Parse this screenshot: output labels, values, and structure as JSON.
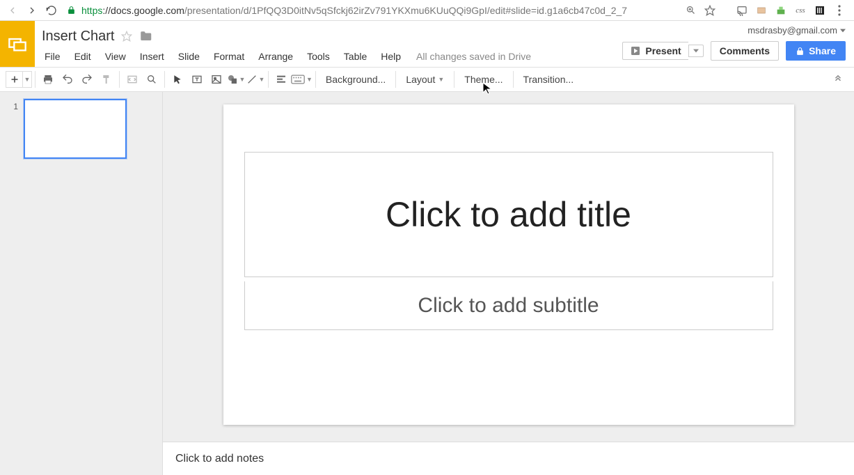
{
  "browser": {
    "url_scheme": "https",
    "url_host": "://docs.google.com",
    "url_path": "/presentation/d/1PfQQ3D0itNv5qSfckj62irZv791YKXmu6KUuQQi9GpI/edit#slide=id.g1a6cb47c0d_2_7",
    "ext_label_css": "css"
  },
  "doc": {
    "title": "Insert Chart",
    "save_status": "All changes saved in Drive"
  },
  "account": {
    "email": "msdrasby@gmail.com"
  },
  "menus": [
    "File",
    "Edit",
    "View",
    "Insert",
    "Slide",
    "Format",
    "Arrange",
    "Tools",
    "Table",
    "Help"
  ],
  "actions": {
    "present": "Present",
    "comments": "Comments",
    "share": "Share"
  },
  "toolbar": {
    "background": "Background...",
    "layout": "Layout",
    "theme": "Theme...",
    "transition": "Transition..."
  },
  "thumb_panel": {
    "slides": [
      {
        "number": "1"
      }
    ]
  },
  "slide": {
    "title_placeholder": "Click to add title",
    "subtitle_placeholder": "Click to add subtitle"
  },
  "notes": {
    "placeholder": "Click to add notes"
  }
}
